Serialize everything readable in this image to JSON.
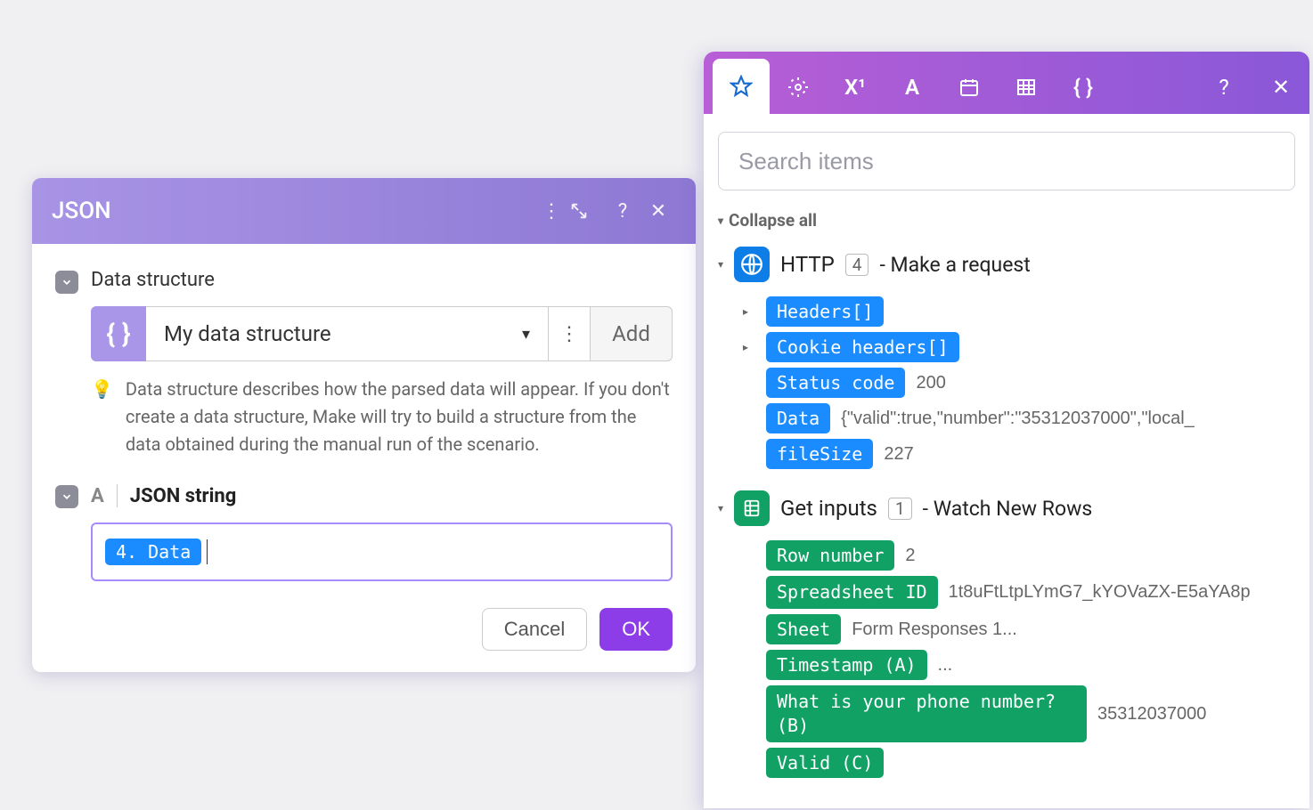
{
  "json_panel": {
    "title": "JSON",
    "data_structure": {
      "label": "Data structure",
      "selected": "My data structure",
      "add_label": "Add",
      "hint": "Data structure describes how the parsed data will appear. If you don't create a data structure, Make will try to build a structure from the data obtained during the manual run of the scenario."
    },
    "json_string": {
      "label": "JSON string",
      "pill": "4. Data"
    },
    "buttons": {
      "cancel": "Cancel",
      "ok": "OK"
    }
  },
  "picker": {
    "search_placeholder": "Search items",
    "collapse_all": "Collapse all",
    "modules": [
      {
        "icon": "http",
        "name": "HTTP",
        "index": "4",
        "subtitle": "- Make a request",
        "pill_color": "blue",
        "items": [
          {
            "label": "Headers[]",
            "expandable": true
          },
          {
            "label": "Cookie headers[]",
            "expandable": true
          },
          {
            "label": "Status code",
            "value": "200"
          },
          {
            "label": "Data",
            "value": "{\"valid\":true,\"number\":\"35312037000\",\"local_"
          },
          {
            "label": "fileSize",
            "value": "227"
          }
        ]
      },
      {
        "icon": "sheets",
        "name": "Get inputs",
        "index": "1",
        "subtitle": "- Watch New Rows",
        "pill_color": "green",
        "items": [
          {
            "label": "Row number",
            "value": "2"
          },
          {
            "label": "Spreadsheet ID",
            "value": "1t8uFtLtpLYmG7_kYOVaZX-E5aYA8p"
          },
          {
            "label": "Sheet",
            "value": "Form Responses 1..."
          },
          {
            "label": "Timestamp (A)",
            "value": "..."
          },
          {
            "label": "What is your phone number? (B)",
            "value": "35312037000"
          },
          {
            "label": "Valid (C)"
          }
        ]
      }
    ]
  }
}
